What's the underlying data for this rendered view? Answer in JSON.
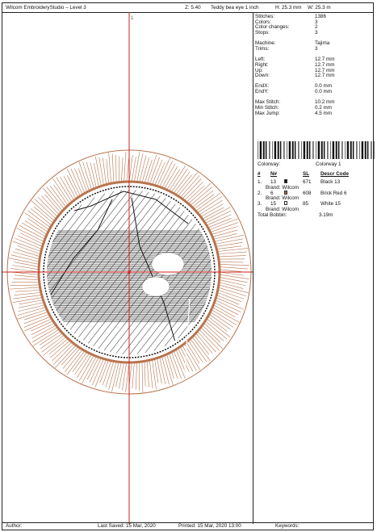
{
  "header": {
    "app_title": "Wilcom EmbroideryStudio – Level 3",
    "zoom": "Z: 5.40",
    "design_name": "Teddy bea eye 1 inch",
    "height": "H: 25.3 mm",
    "width": "W: 25.3 m"
  },
  "stats": {
    "stitches_label": "Stitches:",
    "stitches": "1386",
    "colors_label": "Colors:",
    "colors": "3",
    "color_changes_label": "Color changes:",
    "color_changes": "2",
    "stops_label": "Stops:",
    "stops": "3",
    "machine_label": "Machine:",
    "machine": "Tajima",
    "trims_label": "Trims:",
    "trims": "3",
    "left_label": "Left:",
    "left": "12.7 mm",
    "right_label": "Right:",
    "right": "12.7 mm",
    "up_label": "Up:",
    "up": "12.7 mm",
    "down_label": "Down:",
    "down": "12.7 mm",
    "endx_label": "EndX:",
    "endx": "0.0 mm",
    "endy_label": "EndY:",
    "endy": "0.0 mm",
    "max_stitch_label": "Max Stitch:",
    "max_stitch": "10.2 mm",
    "min_stitch_label": "Min Stitch:",
    "min_stitch": "0.2 mm",
    "max_jump_label": "Max Jump:",
    "max_jump": "4.5 mm"
  },
  "colorway": {
    "label": "Colorway:",
    "value": "Colorway 1"
  },
  "thread_table": {
    "col_num": "#",
    "col_n": "N#",
    "col_sl": "SL",
    "col_desc": "Descr  Code",
    "rows": [
      {
        "idx": "1.",
        "n": "13",
        "sl": "671",
        "desc": "Black 13",
        "swatch": "#141414",
        "brand": "Brand: Wilcom"
      },
      {
        "idx": "2.",
        "n": "6",
        "sl": "608",
        "desc": "Brick Red 6",
        "swatch": "#a86a48",
        "brand": "Brand: Wilcom"
      },
      {
        "idx": "3.",
        "n": "15",
        "sl": "85",
        "desc": "White 15",
        "swatch": "#ffffff",
        "brand": "Brand: Wilcom"
      }
    ],
    "bobbin_label": "Total Bobbin:",
    "bobbin_value": "3.19m"
  },
  "footer": {
    "author": "Author:",
    "last_saved": "Last Saved: 15 Mar, 2020",
    "printed": "Printed: 15 Mar, 2020 13:00",
    "keywords": "Keywords:"
  },
  "axis": {
    "top_mark": "1"
  },
  "colors": {
    "accent": "#d22020",
    "stitch_brown": "#b8744e",
    "black": "#141414"
  }
}
